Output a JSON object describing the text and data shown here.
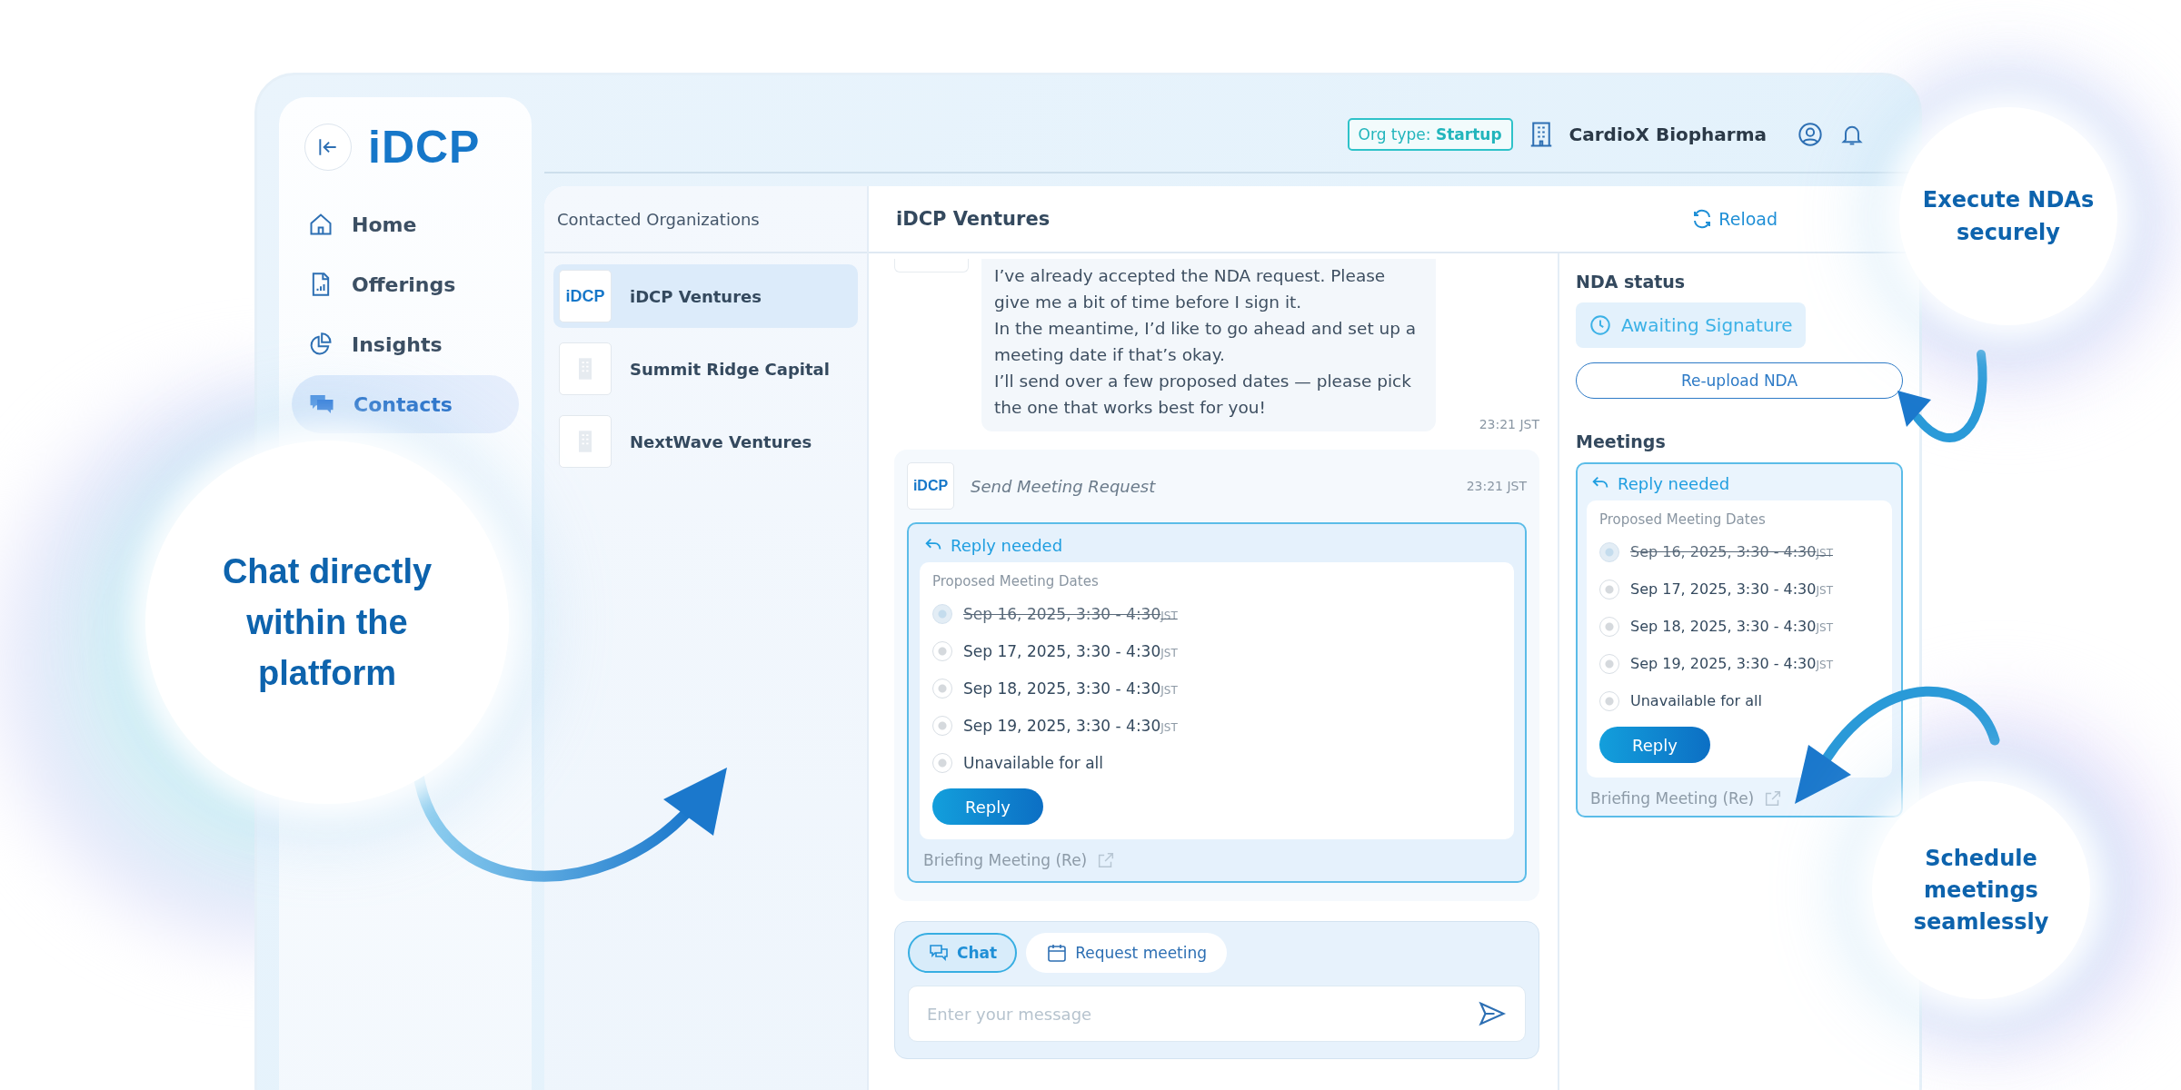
{
  "callouts": [
    {
      "text": "Chat directly within the platform"
    },
    {
      "text": "Execute NDAs securely"
    },
    {
      "text": "Schedule meetings seamlessly"
    }
  ],
  "sidebar": {
    "logo": "iDCP",
    "items": [
      {
        "label": "Home",
        "kind": "home",
        "selected": false
      },
      {
        "label": "Offerings",
        "kind": "offerings",
        "selected": false
      },
      {
        "label": "Insights",
        "kind": "insights",
        "selected": false
      },
      {
        "label": "Contacts",
        "kind": "contacts",
        "selected": true
      }
    ]
  },
  "header": {
    "org_type_label": "Org type:",
    "org_type": "Startup",
    "organization": "CardioX Biopharma"
  },
  "contacts": {
    "title": "Contacted Organizations",
    "items": [
      {
        "name": "iDCP Ventures",
        "kind": "logo",
        "logo": "iDCP",
        "selected": true
      },
      {
        "name": "Summit Ridge Capital",
        "kind": "building",
        "selected": false
      },
      {
        "name": "NextWave Ventures",
        "kind": "building",
        "selected": false
      }
    ]
  },
  "chat": {
    "title": "iDCP Ventures",
    "reload": "Reload",
    "message": {
      "paragraphs": [
        "I’ve already accepted the NDA request. Please give me a bit of time before I sign it.",
        "In the meantime, I’d like to go ahead and set up a meeting date if that’s okay.",
        "I’ll send over a few proposed dates — please pick the one that works best for you!"
      ],
      "time": "23:21 JST"
    },
    "meeting_request": {
      "logo": "iDCP",
      "title": "Send Meeting Request",
      "time": "23:21 JST",
      "status": "Reply needed",
      "dates_label": "Proposed Meeting Dates",
      "options": [
        {
          "label": "Sep 16, 2025, 3:30 - 4:30",
          "tz": "JST",
          "disabled": true,
          "selected": false
        },
        {
          "label": "Sep 17, 2025, 3:30 - 4:30",
          "tz": "JST",
          "disabled": false,
          "selected": false
        },
        {
          "label": "Sep 18, 2025, 3:30 - 4:30",
          "tz": "JST",
          "disabled": false,
          "selected": false
        },
        {
          "label": "Sep 19, 2025, 3:30 - 4:30",
          "tz": "JST",
          "disabled": false,
          "selected": false
        },
        {
          "label": "Unavailable for all",
          "disabled": false,
          "selected": false
        }
      ],
      "reply": "Reply",
      "link": "Briefing Meeting (Re)"
    }
  },
  "composer": {
    "tabs": [
      {
        "label": "Chat",
        "kind": "chat",
        "selected": true
      },
      {
        "label": "Request meeting",
        "kind": "calendar",
        "selected": false
      }
    ],
    "placeholder": "Enter your message"
  },
  "nda": {
    "title": "NDA status",
    "status": "Awaiting Signature",
    "button": "Re-upload NDA"
  },
  "meetings": {
    "title": "Meetings",
    "card": {
      "status": "Reply needed",
      "dates_label": "Proposed Meeting Dates",
      "options": [
        {
          "label": "Sep 16, 2025, 3:30 - 4:30",
          "tz": "JST",
          "disabled": true,
          "selected": false
        },
        {
          "label": "Sep 17, 2025, 3:30 - 4:30",
          "tz": "JST",
          "disabled": false,
          "selected": false
        },
        {
          "label": "Sep 18, 2025, 3:30 - 4:30",
          "tz": "JST",
          "disabled": false,
          "selected": false
        },
        {
          "label": "Sep 19, 2025, 3:30 - 4:30",
          "tz": "JST",
          "disabled": false,
          "selected": false
        },
        {
          "label": "Unavailable for all",
          "disabled": false,
          "selected": false
        }
      ],
      "reply": "Reply",
      "link": "Briefing Meeting (Re)"
    }
  }
}
